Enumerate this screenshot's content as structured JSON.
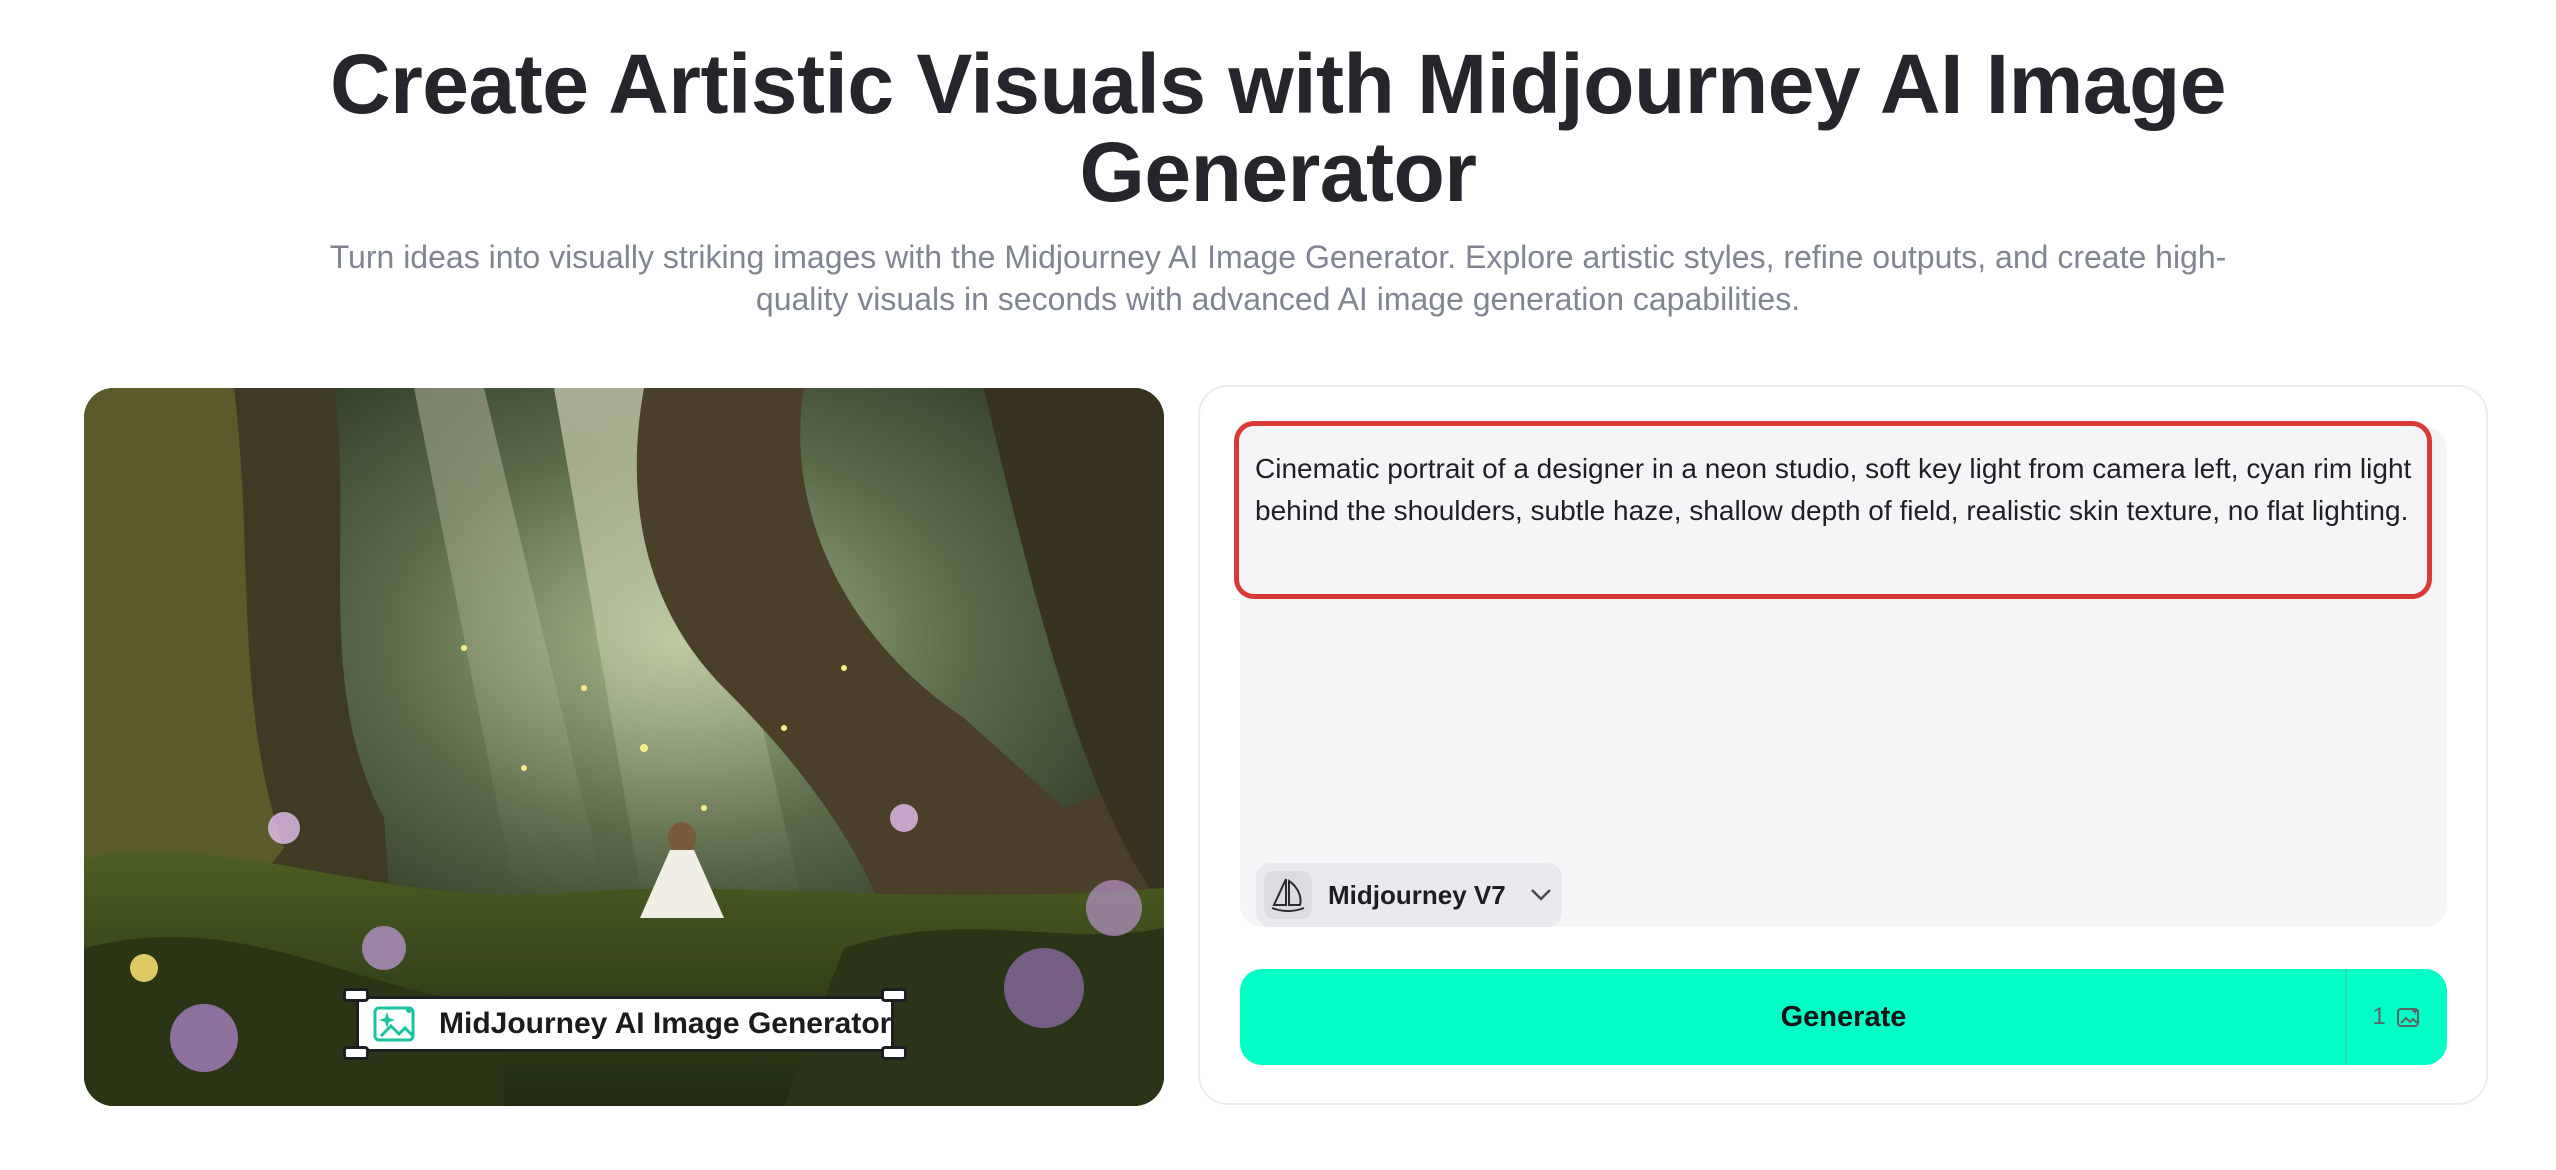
{
  "page": {
    "title": "Create Artistic Visuals with Midjourney AI Image Generator",
    "subtitle": "Turn ideas into visually striking images with the Midjourney AI Image Generator. Explore artistic styles, refine outputs, and create high-quality visuals in seconds with advanced AI image generation capabilities."
  },
  "preview": {
    "label": "MidJourney AI Image Generator",
    "icon": "image-sparkle-icon"
  },
  "prompt": {
    "value": "Cinematic portrait of a designer in a neon studio, soft key light from camera left, cyan rim light behind the shoulders, subtle haze, shallow depth of field, realistic skin texture, no flat lighting."
  },
  "model": {
    "selected": "Midjourney V7",
    "icon": "midjourney-sailboat-icon"
  },
  "generate": {
    "label": "Generate",
    "credits": "1",
    "credit_icon": "image-credit-icon"
  },
  "colors": {
    "accent": "#01ffc6",
    "highlight": "#d93a35",
    "text": "#25262b",
    "muted": "#808592"
  }
}
